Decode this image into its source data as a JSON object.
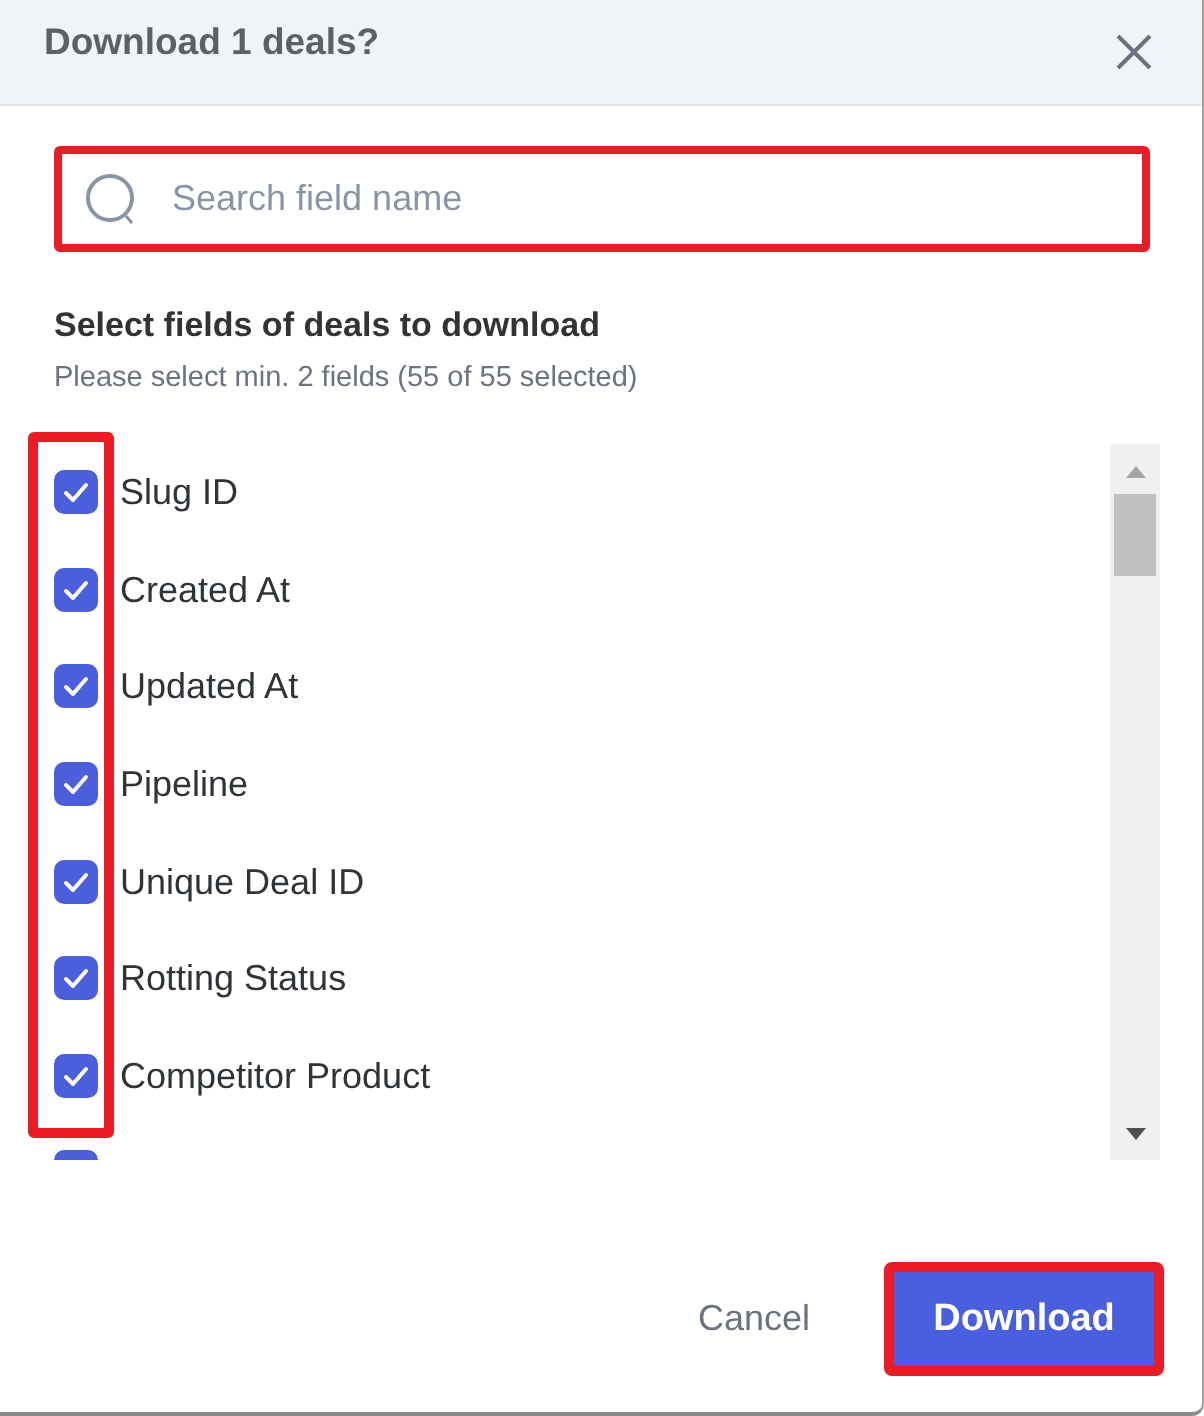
{
  "dialog": {
    "title": "Download 1 deals?"
  },
  "search": {
    "placeholder": "Search field name",
    "highlighted": true
  },
  "section": {
    "title": "Select fields of deals to download",
    "hint": "Please select min. 2 fields (55 of 55 selected)"
  },
  "field_list": {
    "checkbox_highlight": true,
    "items": [
      {
        "label": "Slug ID",
        "checked": true
      },
      {
        "label": "Created At",
        "checked": true
      },
      {
        "label": "Updated At",
        "checked": true
      },
      {
        "label": "Pipeline",
        "checked": true
      },
      {
        "label": "Unique Deal ID",
        "checked": true
      },
      {
        "label": "Rotting Status",
        "checked": true
      },
      {
        "label": "Competitor Product",
        "checked": true
      },
      {
        "checked": true
      }
    ]
  },
  "buttons": [
    {
      "kind": "secondary",
      "label": "Cancel",
      "highlighted": false
    },
    {
      "kind": "primary",
      "label": "Download",
      "highlighted": true
    }
  ]
}
